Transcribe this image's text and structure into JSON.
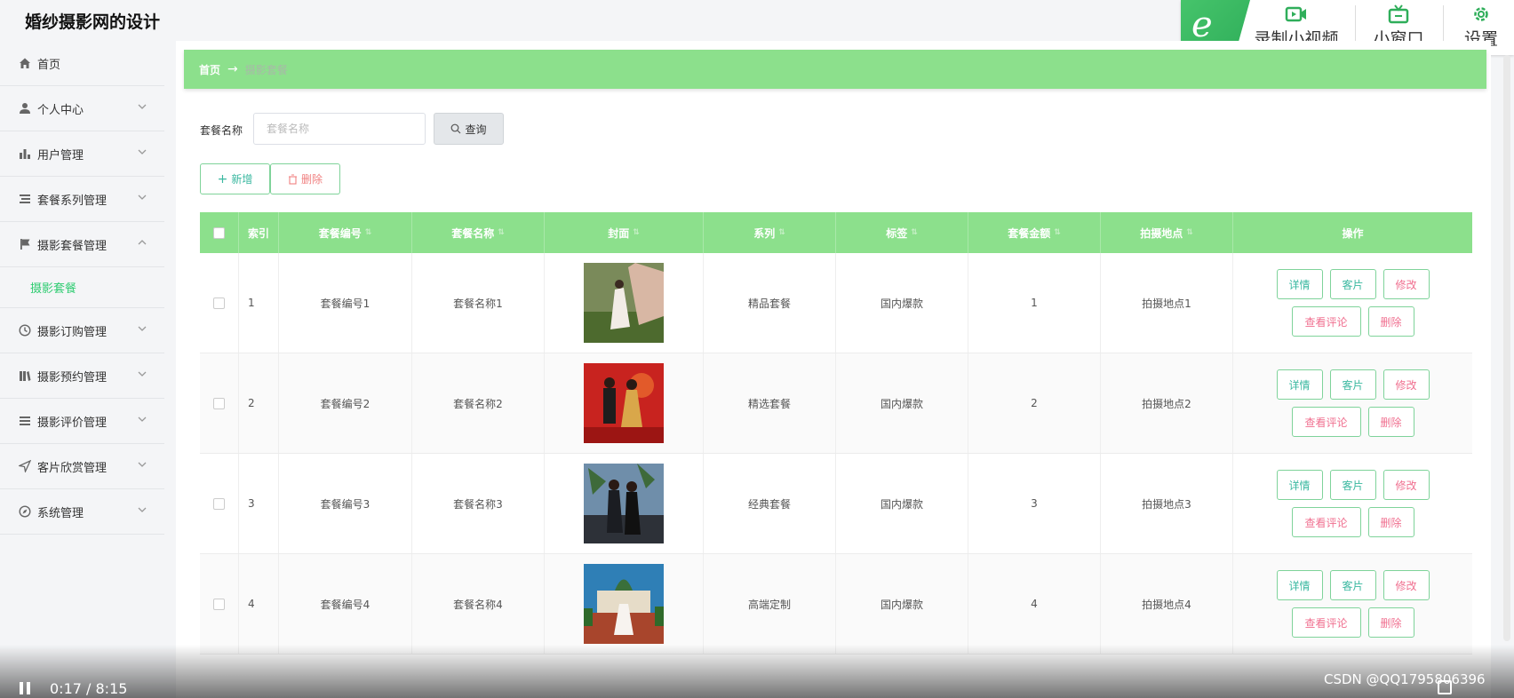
{
  "app": {
    "title": "婚纱摄影网的设计"
  },
  "toolbar": {
    "record_label": "录制小视频",
    "mini_label": "小窗口",
    "settings_label": "设置",
    "logo_glyph": "e"
  },
  "sidebar": {
    "items": [
      {
        "label": "首页",
        "icon": "home-icon"
      },
      {
        "label": "个人中心",
        "icon": "user-icon"
      },
      {
        "label": "用户管理",
        "icon": "bar-chart-icon"
      },
      {
        "label": "套餐系列管理",
        "icon": "list-icon"
      },
      {
        "label": "摄影套餐管理",
        "icon": "flag-icon"
      },
      {
        "label": "摄影订购管理",
        "icon": "clock-icon"
      },
      {
        "label": "摄影预约管理",
        "icon": "books-icon"
      },
      {
        "label": "摄影评价管理",
        "icon": "menu-icon"
      },
      {
        "label": "客片欣赏管理",
        "icon": "send-icon"
      },
      {
        "label": "系统管理",
        "icon": "compass-icon"
      }
    ],
    "sub_item": "摄影套餐"
  },
  "breadcrumb": {
    "home": "首页",
    "arrow": "→",
    "current": "摄影套餐"
  },
  "search": {
    "label": "套餐名称",
    "placeholder": "套餐名称",
    "query_label": "查询"
  },
  "actions": {
    "add_label": "新增",
    "delete_label": "删除"
  },
  "table": {
    "headers": [
      "索引",
      "套餐编号",
      "套餐名称",
      "封面",
      "系列",
      "标签",
      "套餐金额",
      "拍摄地点",
      "操作"
    ],
    "rows": [
      {
        "index": "1",
        "code": "套餐编号1",
        "name": "套餐名称1",
        "series": "精品套餐",
        "tag": "国内爆款",
        "amount": "1",
        "place": "拍摄地点1"
      },
      {
        "index": "2",
        "code": "套餐编号2",
        "name": "套餐名称2",
        "series": "精选套餐",
        "tag": "国内爆款",
        "amount": "2",
        "place": "拍摄地点2"
      },
      {
        "index": "3",
        "code": "套餐编号3",
        "name": "套餐名称3",
        "series": "经典套餐",
        "tag": "国内爆款",
        "amount": "3",
        "place": "拍摄地点3"
      },
      {
        "index": "4",
        "code": "套餐编号4",
        "name": "套餐名称4",
        "series": "高端定制",
        "tag": "国内爆款",
        "amount": "4",
        "place": "拍摄地点4"
      }
    ],
    "op_labels": {
      "detail": "详情",
      "photos": "客片",
      "edit": "修改",
      "reviews": "查看评论",
      "delete": "删除"
    }
  },
  "player": {
    "time": "0:17 / 8:15",
    "watermark": "CSDN @QQ1795806396"
  },
  "colors": {
    "accent": "#8ce08c",
    "teal": "#3ab8a0",
    "pink": "#f07090"
  }
}
